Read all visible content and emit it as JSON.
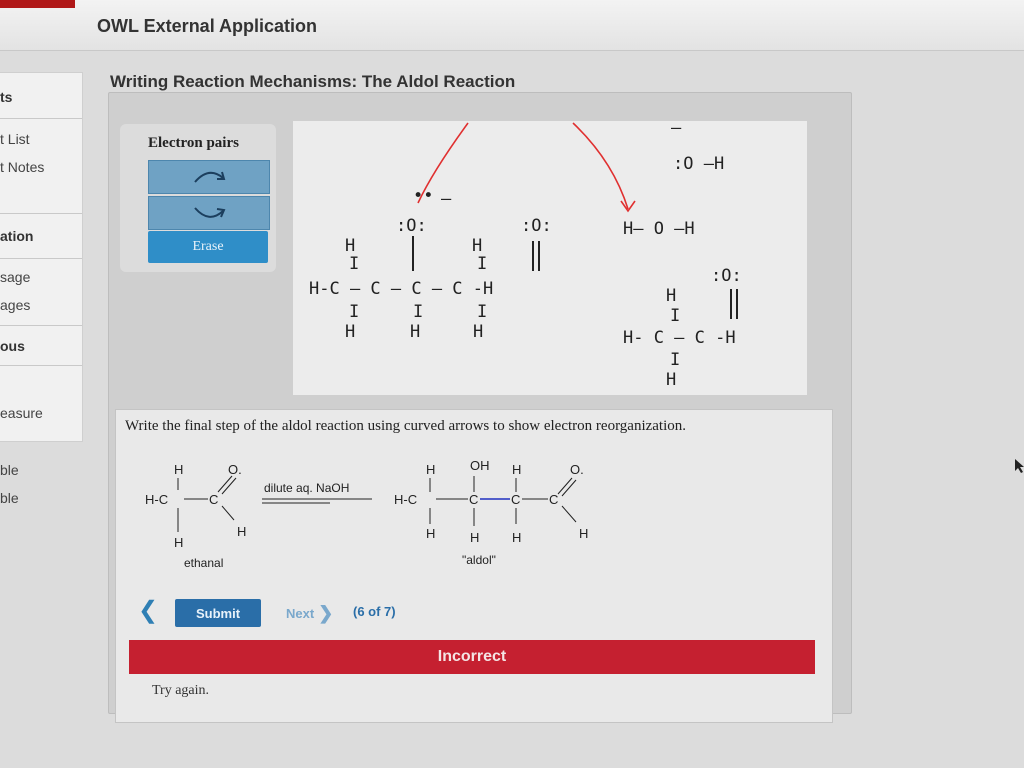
{
  "app": {
    "title": "OWL External Application"
  },
  "sidebar": {
    "items": [
      {
        "label": "ts"
      },
      {
        "label": "t List"
      },
      {
        "label": "t Notes"
      },
      {
        "label": "ation"
      },
      {
        "label": "sage"
      },
      {
        "label": "ages"
      },
      {
        "label": "ous"
      },
      {
        "label": "easure"
      }
    ],
    "extra": [
      "ble",
      "ble"
    ]
  },
  "page": {
    "heading": "Writing Reaction Mechanisms: The Aldol Reaction"
  },
  "tools": {
    "label": "Electron pairs",
    "erase_label": "Erase"
  },
  "mechanism": {
    "left": {
      "h_top1": "H",
      "h_top2": "H",
      "h_top3": "",
      "o1": ":O:",
      "o2": ":O:",
      "chain": "H-C — C — C — C -H",
      "h_bot1": "H",
      "h_bot2": "H",
      "h_bot3": "H",
      "vert_bars": "I",
      "minus_sign": "–",
      "dots": "••"
    },
    "right": {
      "hydroxide": ":O —H",
      "water": "H— O —H",
      "carbonyl_o": ":O:",
      "h_top": "H",
      "chain": "H- C — C -H",
      "h_bot": "H",
      "minus_sign": "–",
      "bar": "I"
    }
  },
  "question": {
    "prompt": "Write the final step of the aldol reaction using curved arrows to show electron reorganization.",
    "reagent": "dilute aq. NaOH",
    "reactant_name": "ethanal",
    "product_name": "\"aldol\"",
    "atoms": {
      "h": "H",
      "c": "C",
      "o": "O.",
      "oh": "OH",
      "hc": "H-C"
    }
  },
  "nav": {
    "prev": "❮",
    "submit": "Submit",
    "next": "Next",
    "next_chevron": "❯",
    "counter": "(6 of 7)"
  },
  "feedback": {
    "status": "Incorrect",
    "message": "Try again."
  },
  "colors": {
    "accent": "#2a6ea8",
    "error": "#c52030",
    "arrow": "#e03030"
  }
}
